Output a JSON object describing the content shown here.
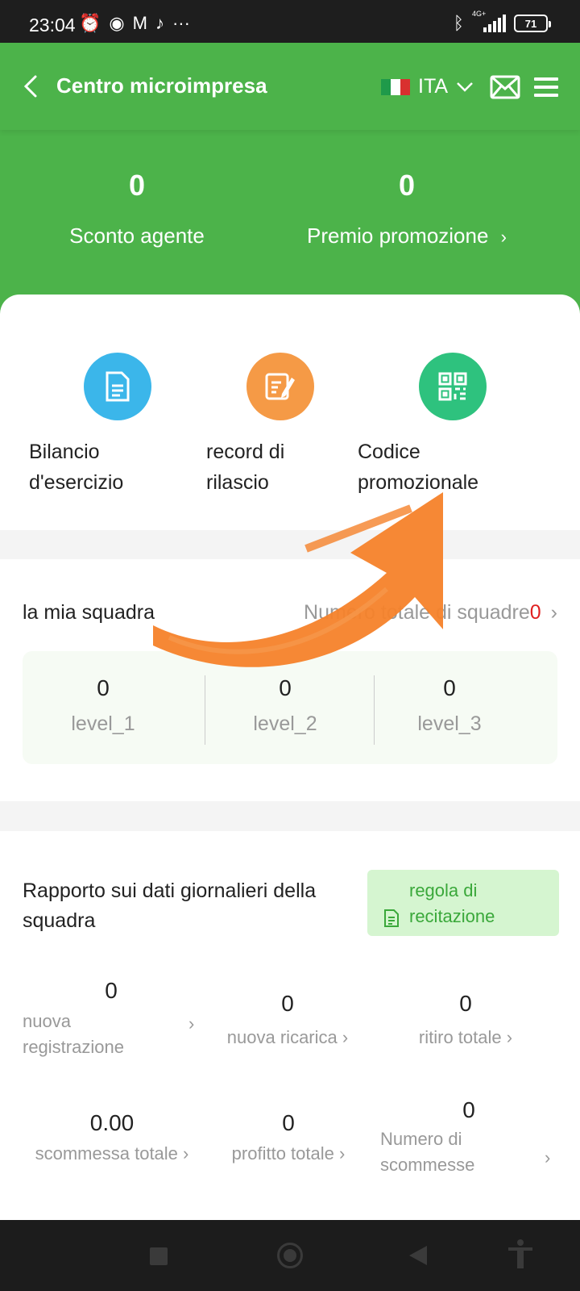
{
  "status_bar": {
    "time": "23:04",
    "network": "4G+",
    "battery": "71"
  },
  "header": {
    "title": "Centro microimpresa",
    "language": "ITA"
  },
  "summary": {
    "agent_discount": {
      "value": "0",
      "label": "Sconto agente"
    },
    "promotion_bonus": {
      "value": "0",
      "label": "Premio promozione"
    }
  },
  "actions": [
    {
      "label_line1": "Bilancio",
      "label_line2": "d'esercizio",
      "icon": "document-icon",
      "color": "#3bb6ea"
    },
    {
      "label_line1": "record di",
      "label_line2": "rilascio",
      "icon": "edit-document-icon",
      "color": "#f59a46"
    },
    {
      "label_line1": "Codice",
      "label_line2": "promozionale",
      "icon": "qr-code-icon",
      "color": "#2ec27e"
    }
  ],
  "team": {
    "title": "la mia squadra",
    "total_label": "Numero totale di squadre",
    "total_value": "0",
    "levels": [
      {
        "value": "0",
        "name": "level_1"
      },
      {
        "value": "0",
        "name": "level_2"
      },
      {
        "value": "0",
        "name": "level_3"
      }
    ]
  },
  "report": {
    "title": "Rapporto sui dati giornalieri della squadra",
    "rule_button": {
      "line1": "regola di",
      "line2": "recitazione"
    },
    "stats": [
      {
        "value": "0",
        "label_line1": "nuova",
        "label_line2": "registrazione"
      },
      {
        "value": "0",
        "label_line1": "nuova ricarica",
        "label_line2": ""
      },
      {
        "value": "0",
        "label_line1": "ritiro totale",
        "label_line2": ""
      },
      {
        "value": "0.00",
        "label_line1": "scommessa totale",
        "label_line2": ""
      },
      {
        "value": "0",
        "label_line1": "profitto totale",
        "label_line2": ""
      },
      {
        "value": "0",
        "label_line1": "Numero di",
        "label_line2": "scommesse"
      }
    ]
  },
  "colors": {
    "brand_green": "#4cb34a",
    "annotation_orange": "#f5822a",
    "alert_red": "#e02020"
  }
}
